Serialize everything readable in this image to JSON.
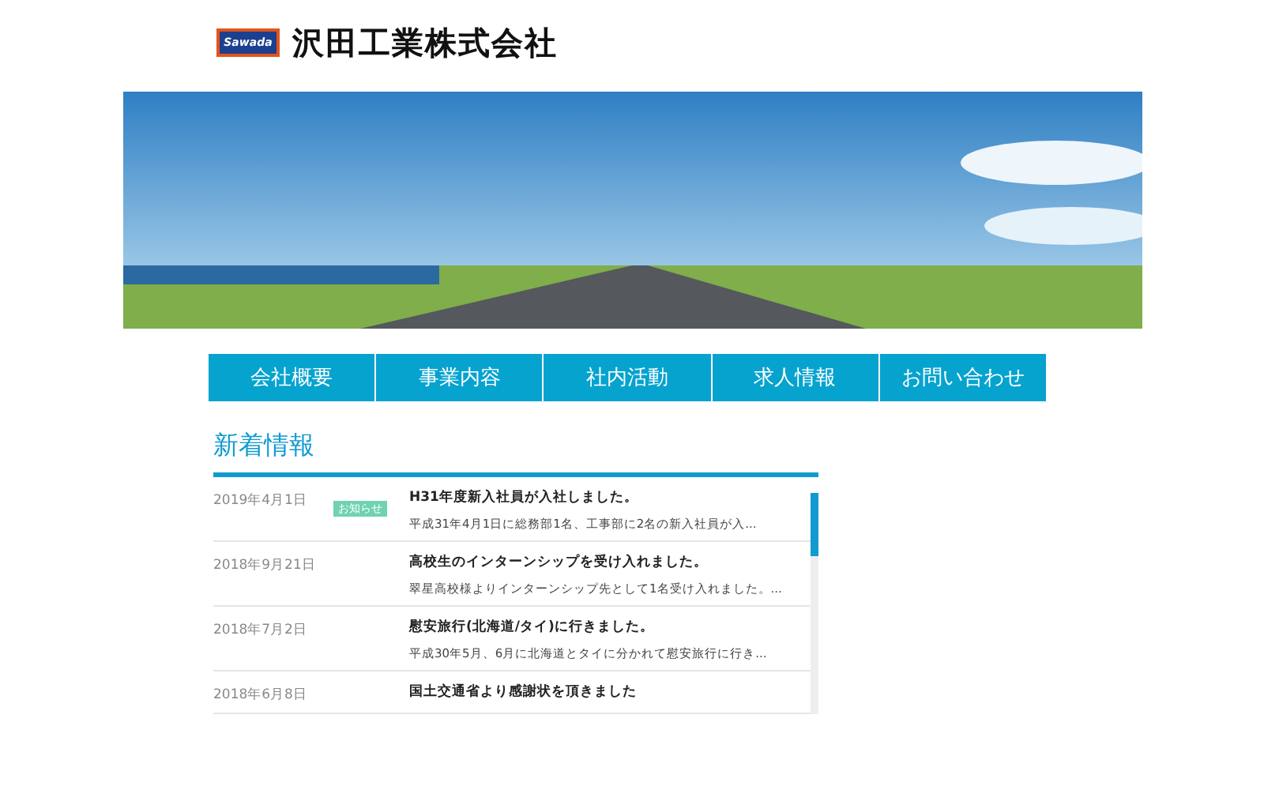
{
  "logo": {
    "mark": "Sawada",
    "name": "沢田工業株式会社"
  },
  "nav": [
    {
      "label": "会社概要"
    },
    {
      "label": "事業内容"
    },
    {
      "label": "社内活動"
    },
    {
      "label": "求人情報"
    },
    {
      "label": "お問い合わせ"
    }
  ],
  "news": {
    "title": "新着情報",
    "items": [
      {
        "date": "2019年4月1日",
        "tag": "お知らせ",
        "title": "H31年度新入社員が入社しました。",
        "summary": "平成31年4月1日に総務部1名、工事部に2名の新入社員が入..."
      },
      {
        "date": "2018年9月21日",
        "title": "高校生のインターンシップを受け入れました。",
        "summary": "翠星高校様よりインターンシップ先として1名受け入れました。..."
      },
      {
        "date": "2018年7月2日",
        "title": "慰安旅行(北海道/タイ)に行きました。",
        "summary": "平成30年5月、6月に北海道とタイに分かれて慰安旅行に行き..."
      },
      {
        "date": "2018年6月8日",
        "title": "国土交通省より感謝状を頂きました"
      }
    ]
  }
}
